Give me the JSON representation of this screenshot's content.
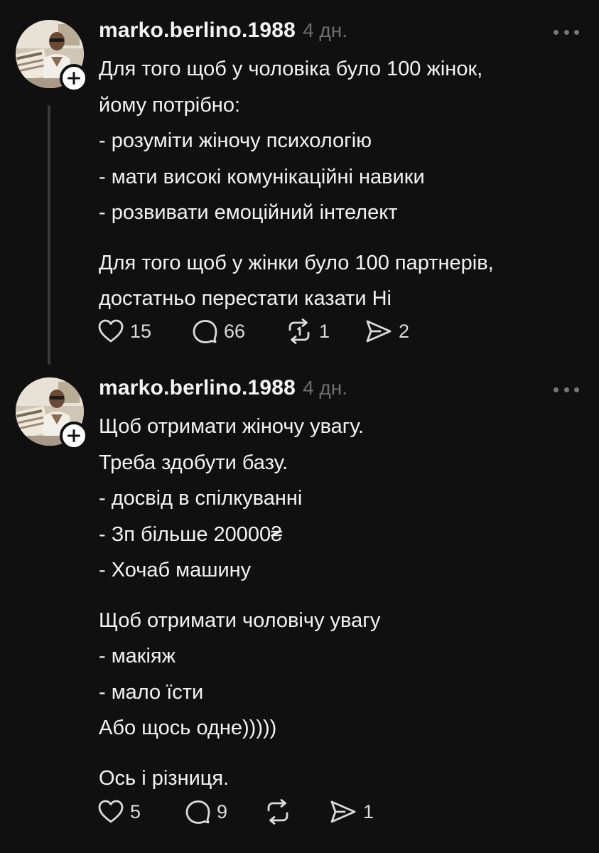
{
  "posts": [
    {
      "username": "marko.berlino.1988",
      "time": "4 дн.",
      "lines": [
        "Для того щоб у чоловіка було 100 жінок,",
        "йому потрібно:",
        "- розуміти жіночу психологію",
        "- мати високі комунікаційні навики",
        "- розвивати емоційний інтелект",
        "",
        "Для того щоб у жінки було 100 партнерів,",
        "достатньо перестати казати Ні"
      ],
      "likes": "15",
      "comments": "66",
      "reposts": "1",
      "shares": "2"
    },
    {
      "username": "marko.berlino.1988",
      "time": "4 дн.",
      "lines": [
        "Щоб отримати жіночу увагу.",
        "Треба здобути базу.",
        "- досвід в спілкуванні",
        "- Зп більше 20000₴",
        "- Хочаб машину",
        "",
        "Щоб отримати чоловічу увагу",
        "- макіяж",
        "- мало їсти",
        "Або щось одне)))))",
        "",
        "Ось і різниця."
      ],
      "likes": "5",
      "comments": "9",
      "reposts": "",
      "shares": "1"
    }
  ],
  "icons": {
    "like": "heart-icon",
    "comment": "comment-bubble-icon",
    "repost": "repost-icon",
    "share": "send-icon",
    "more": "more-horizontal-icon",
    "follow": "plus-icon"
  },
  "colors": {
    "background": "#101010",
    "text": "#f3f3f3",
    "muted": "#6f6f6f",
    "thread_line": "#3a3a3a"
  }
}
